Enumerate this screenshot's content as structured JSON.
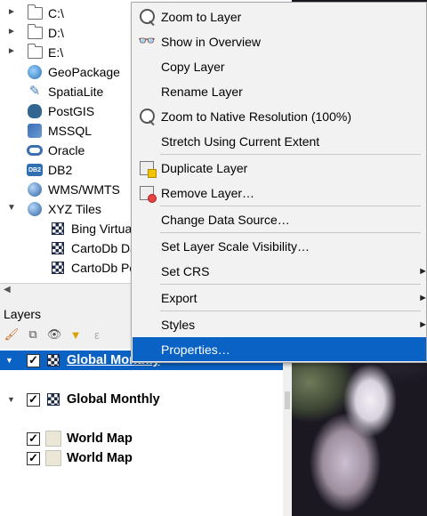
{
  "browser": {
    "items": [
      {
        "label": "C:\\",
        "icon": "folder-icon",
        "expand": "►"
      },
      {
        "label": "D:\\",
        "icon": "folder-icon",
        "expand": "►"
      },
      {
        "label": "E:\\",
        "icon": "folder-icon",
        "expand": "►"
      },
      {
        "label": "GeoPackage",
        "icon": "geopackage-icon"
      },
      {
        "label": "SpatiaLite",
        "icon": "spatialite-icon"
      },
      {
        "label": "PostGIS",
        "icon": "postgis-icon"
      },
      {
        "label": "MSSQL",
        "icon": "mssql-icon"
      },
      {
        "label": "Oracle",
        "icon": "oracle-icon"
      },
      {
        "label": "DB2",
        "icon": "db2-icon",
        "icon_text": "DB2"
      },
      {
        "label": "WMS/WMTS",
        "icon": "globe-icon"
      },
      {
        "label": "XYZ Tiles",
        "icon": "globe-icon",
        "expand": "▼"
      },
      {
        "label": "Bing Virtual Earth",
        "icon": "tile-icon"
      },
      {
        "label": "CartoDb Dark",
        "icon": "tile-icon"
      },
      {
        "label": "CartoDb Positron",
        "icon": "tile-icon"
      }
    ]
  },
  "layers": {
    "title": "Layers",
    "rows": [
      {
        "label": "Global Monthly",
        "checked": "✓",
        "expand": "▼",
        "selected": true
      },
      {
        "label": "Global Monthly",
        "checked": "✓",
        "expand": "▼"
      },
      {
        "label": "World Map",
        "checked": "✓"
      },
      {
        "label": "World Map",
        "checked": "✓"
      }
    ]
  },
  "menu": {
    "items": [
      {
        "label": "Zoom to Layer",
        "icon": "zoom-to-layer-icon"
      },
      {
        "label": "Show in Overview",
        "icon": "glasses-icon"
      },
      {
        "label": "Copy Layer"
      },
      {
        "label": "Rename Layer"
      },
      {
        "label": "Zoom to Native Resolution (100%)",
        "icon": "zoom-native-icon"
      },
      {
        "label": "Stretch Using Current Extent"
      },
      {
        "label": "Duplicate Layer",
        "icon": "duplicate-layer-icon"
      },
      {
        "label": "Remove Layer…",
        "icon": "remove-layer-icon"
      },
      {
        "label": "Change Data Source…"
      },
      {
        "label": "Set Layer Scale Visibility…"
      },
      {
        "label": "Set CRS",
        "submenu": "►"
      },
      {
        "label": "Export",
        "submenu": "►"
      },
      {
        "label": "Styles",
        "submenu": "►"
      },
      {
        "label": "Properties…",
        "active": true
      }
    ]
  },
  "colors": {
    "selection": "#0a62c4",
    "menu_bg": "#f2f2f2"
  }
}
